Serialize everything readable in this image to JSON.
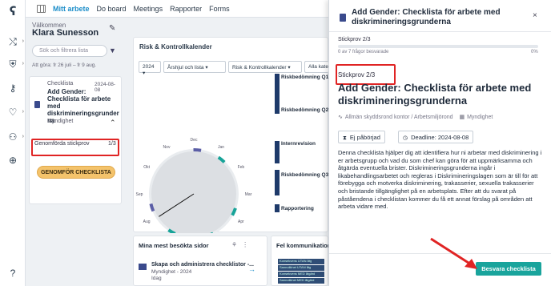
{
  "colors": {
    "accent": "#1d8ec9",
    "highlight": "#e02424",
    "cta": "#f4c36b",
    "answer": "#19a49c",
    "navy": "#1e3a6a",
    "teal_arc": "#17a398",
    "purple_arc": "#5b5ea6"
  },
  "rail": {
    "icons": [
      "logo-icon",
      "shuffle-icon",
      "shield-icon",
      "key-icon",
      "heart-icon",
      "people-icon",
      "plus-circle-icon",
      "help-icon"
    ]
  },
  "topnav": {
    "items": [
      {
        "label": "Mitt arbete",
        "active": true
      },
      {
        "label": "Do board",
        "active": false
      },
      {
        "label": "Meetings",
        "active": false
      },
      {
        "label": "Rapporter",
        "active": false
      },
      {
        "label": "Forms",
        "active": false
      }
    ]
  },
  "welcome": {
    "greeting": "Välkommen",
    "name": "Klara Sunesson",
    "search_placeholder": "Sök och filtrera lista",
    "period": "Att göra: fr 26 juli – fr 9 aug.",
    "card": {
      "type": "Checklista",
      "date": "2024-08-08",
      "title": "Add Gender: Checklista för arbete med diskrimineringsgrunder na",
      "meta": "Myndighet",
      "progress_label": "Genomförda stickprov",
      "progress_count": "1/3",
      "cta": "GENOMFÖR CHECKLISTA"
    }
  },
  "calendar": {
    "title": "Risk & Kontrollkalender",
    "filters": [
      "2024",
      "Årshjul och lista",
      "Risk & Kontrollkalender",
      "Alla kate"
    ],
    "months": [
      "Dec",
      "Jan",
      "Feb",
      "Mar",
      "Apr",
      "Maj",
      "Jun",
      "Jul",
      "Aug",
      "Sep",
      "Okt",
      "Nov"
    ],
    "legend": [
      "Riskbedömning Q1",
      "Riskbedömning Q2",
      "Internrevision",
      "Riskbedömning Q3",
      "Rapportering"
    ]
  },
  "visits": {
    "title": "Mina mest besökta sidor",
    "item_title": "Skapa och administrera checklistor -...",
    "item_sub1": "Myndighet - 2024",
    "item_sub2": "Idag"
  },
  "fel": {
    "title": "Fel kommunikation",
    "rows": [
      "Konsekvens UTAN åtg",
      "Sannolikhet UTAN åtg",
      "Konsekvens MED åtgärd",
      "Sannolikhet MED åtgärd"
    ]
  },
  "drawer": {
    "title": "Add Gender: Checklista för arbete med diskrimineringsgrunderna",
    "stickprov": "Stickprov 2/3",
    "progress": 0,
    "answered": "0 av 7 frågor besvarade",
    "pct": "0%",
    "stickprov2": "Stickprov 2/3",
    "big_title": "Add Gender: Checklista för arbete med diskrimineringsgrunderna",
    "chip_org": "Allmän skyddsrond kontor / Arbetsmiljörond",
    "chip_type": "Myndighet",
    "status": "Ej påbörjad",
    "deadline": "Deadline: 2024-08-08",
    "description": "Denna checklista hjälper dig att identifiera hur ni arbetar med diskriminering i er arbetsgrupp och vad du som chef kan göra för att uppmärksamma och åtgärda eventuella brister. Diskrimineringsgrunderna ingår i likabehandlingsarbetet och regleras i Diskrimineringslagen som är till för att förebygga och motverka diskriminering, trakasserier, sexuella trakasserier och bristande tillgänglighet på en arbetsplats. Efter att du svarat på påståendena i checklistan kommer du få ett annat förslag på områden att arbeta vidare med.",
    "answer_button": "Besvara checklista"
  }
}
